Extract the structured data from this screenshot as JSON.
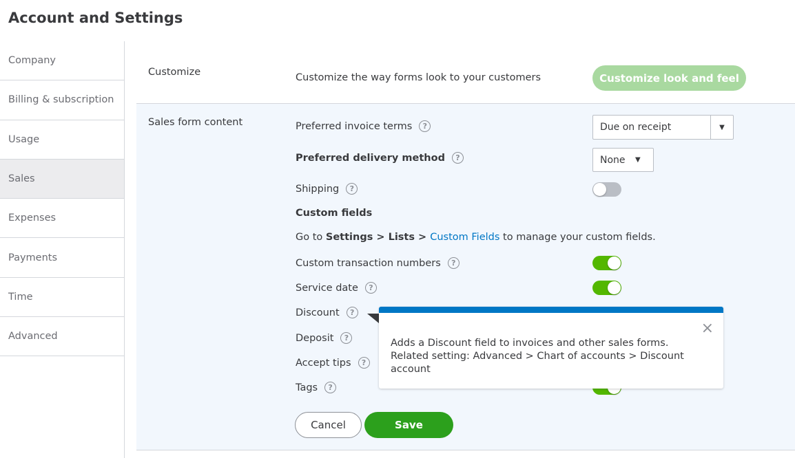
{
  "title": "Account and Settings",
  "sidebar": {
    "items": [
      {
        "label": "Company"
      },
      {
        "label": "Billing & subscription"
      },
      {
        "label": "Usage"
      },
      {
        "label": "Sales",
        "selected": true
      },
      {
        "label": "Expenses"
      },
      {
        "label": "Payments"
      },
      {
        "label": "Time"
      },
      {
        "label": "Advanced"
      }
    ]
  },
  "customize": {
    "section": "Customize",
    "description": "Customize the way forms look to your customers",
    "button": "Customize look and feel"
  },
  "sales_form": {
    "section": "Sales form content",
    "invoice_terms": {
      "label": "Preferred invoice terms",
      "value": "Due on receipt"
    },
    "delivery": {
      "label": "Preferred delivery method",
      "value": "None"
    },
    "shipping": {
      "label": "Shipping",
      "on": false
    },
    "custom_fields": {
      "heading": "Custom fields",
      "pre": "Go to ",
      "path": "Settings > Lists > ",
      "link": "Custom Fields",
      "post": " to manage your custom fields."
    },
    "custom_txn": {
      "label": "Custom transaction numbers",
      "on": true
    },
    "service_date": {
      "label": "Service date",
      "on": true
    },
    "discount": {
      "label": "Discount"
    },
    "deposit": {
      "label": "Deposit"
    },
    "tips": {
      "label": "Accept tips"
    },
    "tags": {
      "label": "Tags",
      "on": true
    }
  },
  "help_glyph": "?",
  "tooltip": {
    "text": "Adds a Discount field to invoices and other sales forms. Related setting: Advanced > Chart of accounts > Discount account",
    "close": "×"
  },
  "buttons": {
    "cancel": "Cancel",
    "save": "Save"
  },
  "colors": {
    "accent_green": "#2ca01c",
    "toggle_on": "#53b700",
    "link": "#0077c5"
  }
}
